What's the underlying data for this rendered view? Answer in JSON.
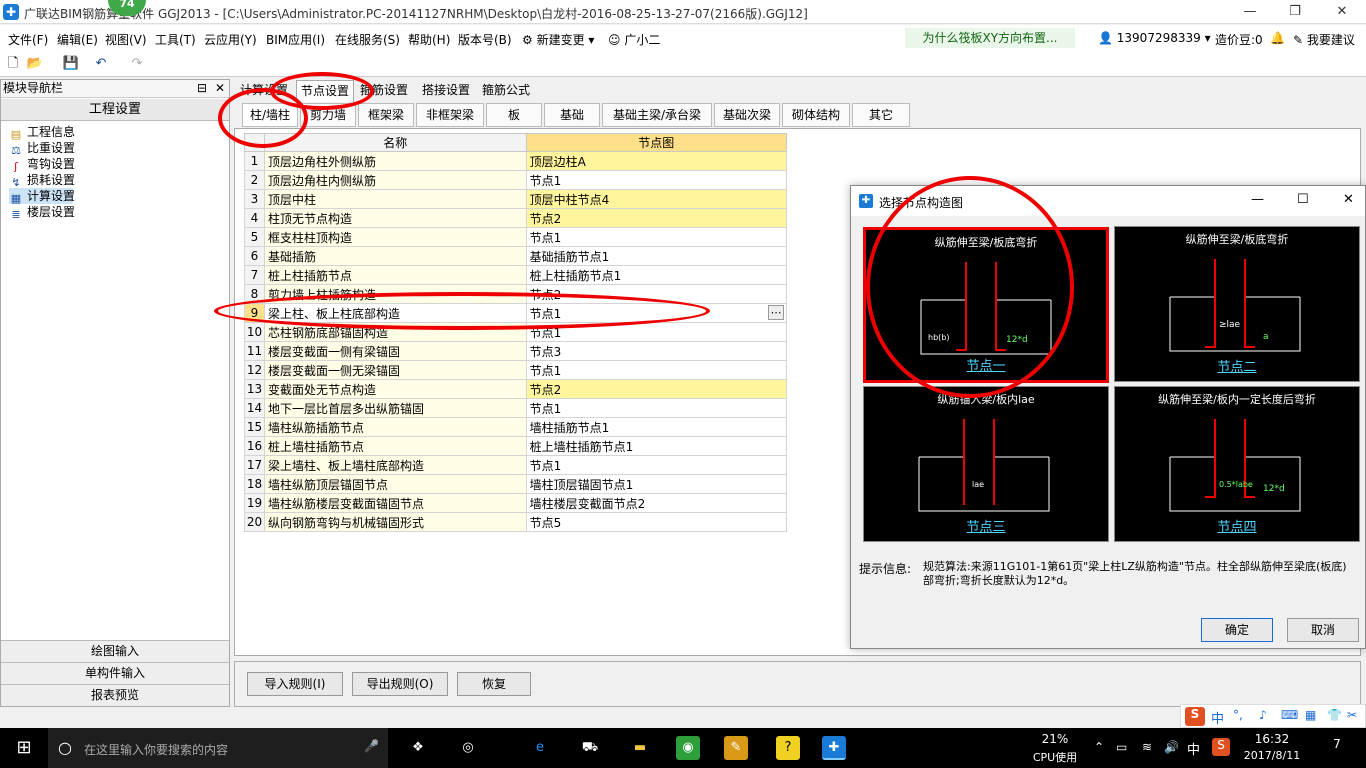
{
  "window": {
    "title": "广联达BIM钢筋算量软件 GGJ2013 - [C:\\Users\\Administrator.PC-20141127NRHM\\Desktop\\白龙村-2016-08-25-13-27-07(2166版).GGJ12]",
    "badge": "74"
  },
  "menu": {
    "items": [
      "文件(F)",
      "编辑(E)",
      "视图(V)",
      "工具(T)",
      "云应用(Y)",
      "BIM应用(I)",
      "在线服务(S)",
      "帮助(H)",
      "版本号(B)",
      "新建变更",
      "广小二"
    ],
    "question": "为什么筏板XY方向布置...",
    "phone": "13907298339",
    "coins": "造价豆:0",
    "suggest": "我要建议"
  },
  "nav": {
    "header": "模块导航栏",
    "group": "工程设置",
    "items": [
      "工程信息",
      "比重设置",
      "弯钩设置",
      "损耗设置",
      "计算设置",
      "楼层设置"
    ],
    "bottom": [
      "绘图输入",
      "单构件输入",
      "报表预览"
    ]
  },
  "tabs": [
    "计算设置",
    "节点设置",
    "箍筋设置",
    "搭接设置",
    "箍筋公式"
  ],
  "subtabs": [
    "柱/墙柱",
    "剪力墙",
    "框架梁",
    "非框架梁",
    "板",
    "基础",
    "基础主梁/承台梁",
    "基础次梁",
    "砌体结构",
    "其它"
  ],
  "table": {
    "headers": [
      "名称",
      "节点图"
    ],
    "rows": [
      {
        "n": "1",
        "name": "顶层边角柱外侧纵筋",
        "val": "顶层边柱A"
      },
      {
        "n": "2",
        "name": "顶层边角柱内侧纵筋",
        "val": "节点1"
      },
      {
        "n": "3",
        "name": "顶层中柱",
        "val": "顶层中柱节点4"
      },
      {
        "n": "4",
        "name": "柱顶无节点构造",
        "val": "节点2"
      },
      {
        "n": "5",
        "name": "框支柱柱顶构造",
        "val": "节点1"
      },
      {
        "n": "6",
        "name": "基础插筋",
        "val": "基础插筋节点1"
      },
      {
        "n": "7",
        "name": "桩上柱插筋节点",
        "val": "桩上柱插筋节点1"
      },
      {
        "n": "8",
        "name": "剪力墙上柱插筋构造",
        "val": "节点2"
      },
      {
        "n": "9",
        "name": "梁上柱、板上柱底部构造",
        "val": "节点1"
      },
      {
        "n": "10",
        "name": "芯柱钢筋底部锚固构造",
        "val": "节点1"
      },
      {
        "n": "11",
        "name": "楼层变截面一侧有梁锚固",
        "val": "节点3"
      },
      {
        "n": "12",
        "name": "楼层变截面一侧无梁锚固",
        "val": "节点1"
      },
      {
        "n": "13",
        "name": "变截面处无节点构造",
        "val": "节点2"
      },
      {
        "n": "14",
        "name": "地下一层比首层多出纵筋锚固",
        "val": "节点1"
      },
      {
        "n": "15",
        "name": "墙柱纵筋插筋节点",
        "val": "墙柱插筋节点1"
      },
      {
        "n": "16",
        "name": "桩上墙柱插筋节点",
        "val": "桩上墙柱插筋节点1"
      },
      {
        "n": "17",
        "name": "梁上墙柱、板上墙柱底部构造",
        "val": "节点1"
      },
      {
        "n": "18",
        "name": "墙柱纵筋顶层锚固节点",
        "val": "墙柱顶层锚固节点1"
      },
      {
        "n": "19",
        "name": "墙柱纵筋楼层变截面锚固节点",
        "val": "墙柱楼层变截面节点2"
      },
      {
        "n": "20",
        "name": "纵向钢筋弯钩与机械锚固形式",
        "val": "节点5"
      }
    ]
  },
  "buttons": {
    "import": "导入规则(I)",
    "export": "导出规则(O)",
    "restore": "恢复"
  },
  "dialog": {
    "title": "选择节点构造图",
    "nodes": [
      {
        "title": "纵筋伸至梁/板底弯折",
        "name": "节点一"
      },
      {
        "title": "纵筋伸至梁/板底弯折",
        "name": "节点二"
      },
      {
        "title": "纵筋锚入梁/板内lae",
        "name": "节点三"
      },
      {
        "title": "纵筋伸至梁/板内一定长度后弯折",
        "name": "节点四"
      }
    ],
    "hint_label": "提示信息:",
    "hint": "规范算法:来源11G101-1第61页\"梁上柱LZ纵筋构造\"节点。柱全部纵筋伸至梁底(板底)部弯折;弯折长度默认为12*d。",
    "ok": "确定",
    "cancel": "取消"
  },
  "taskbar": {
    "search": "在这里输入你要搜索的内容",
    "cpu": "21%",
    "cpu_label": "CPU使用",
    "lang": "中",
    "time": "16:32",
    "date": "2017/8/11",
    "notif": "7"
  }
}
